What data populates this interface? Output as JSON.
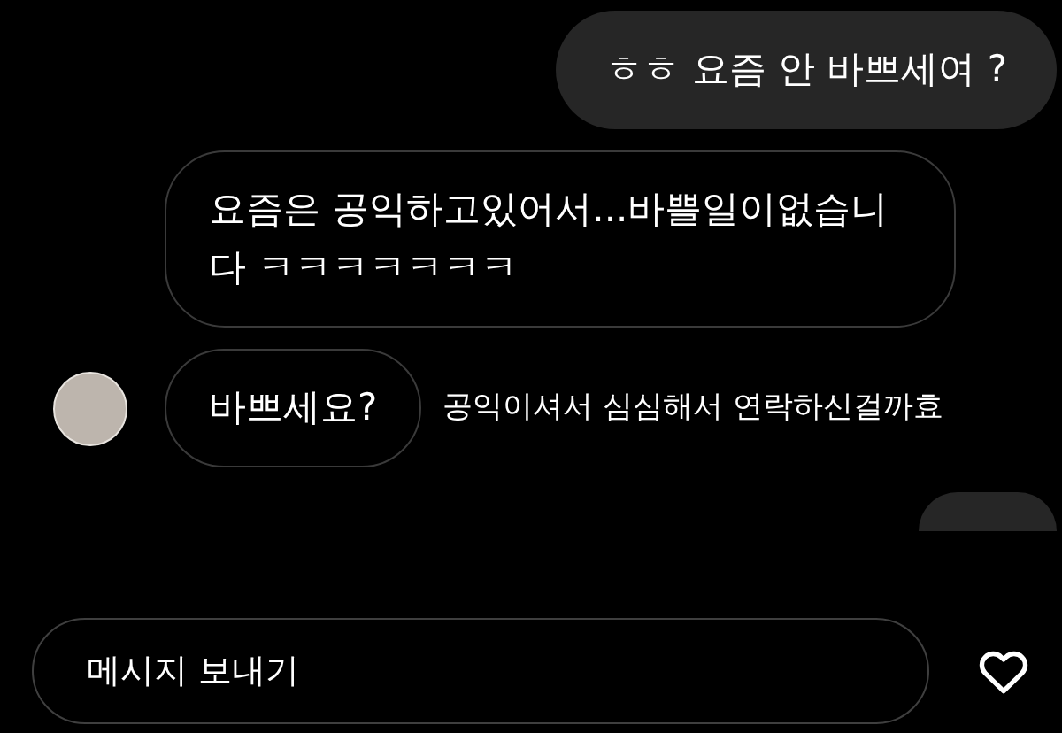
{
  "messages": [
    {
      "kind": "sent",
      "text": "ㅎㅎ 요즘 안 바쁘세여 ?"
    },
    {
      "kind": "received",
      "text": "요즘은 공익하고있어서...바쁠일이없습니다 ㅋㅋㅋㅋㅋㅋㅋ",
      "avatar": false
    },
    {
      "kind": "received",
      "text": "바쁘세요?",
      "avatar": true,
      "note": "공익이셔서 심심해서 연락하신걸까효"
    },
    {
      "kind": "sent_partial"
    }
  ],
  "composer": {
    "placeholder": "메시지 보내기"
  }
}
